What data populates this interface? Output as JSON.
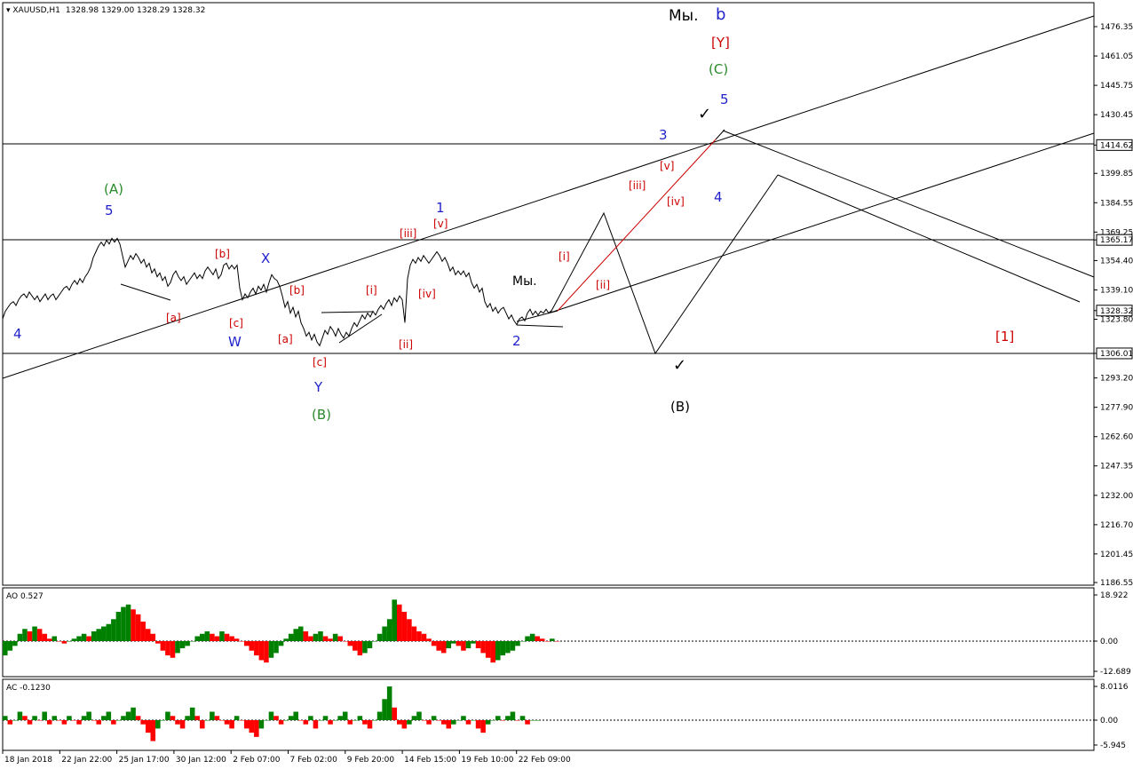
{
  "chart_data": {
    "type": "line",
    "header": {
      "symbol": "XAUUSD,H1",
      "ohlc": "1328.98 1329.00 1328.29 1328.32"
    },
    "price_axis": {
      "min": 1186.55,
      "max": 1476.35,
      "ticks": [
        "1476.35",
        "1461.05",
        "1445.75",
        "1430.45",
        "1414.62",
        "1399.85",
        "1384.55",
        "1369.25",
        "1365.17",
        "1354.40",
        "1339.10",
        "1328.32",
        "1323.80",
        "1306.01",
        "1293.20",
        "1277.90",
        "1262.60",
        "1247.35",
        "1232.00",
        "1216.70",
        "1201.45",
        "1186.55"
      ],
      "highlight_levels": [
        "1414.62",
        "1365.17",
        "1306.01",
        "1328.32"
      ]
    },
    "time_axis": {
      "ticks": [
        "18 Jan 2018",
        "22 Jan 22:00",
        "25 Jan 17:00",
        "30 Jan 12:00",
        "2 Feb 07:00",
        "7 Feb 02:00",
        "9 Feb 20:00",
        "14 Feb 15:00",
        "19 Feb 10:00",
        "22 Feb 09:00"
      ]
    },
    "price_series": [
      [
        0,
        1324
      ],
      [
        3,
        1328
      ],
      [
        6,
        1330
      ],
      [
        9,
        1332
      ],
      [
        12,
        1333
      ],
      [
        15,
        1331
      ],
      [
        18,
        1334
      ],
      [
        21,
        1336
      ],
      [
        24,
        1337
      ],
      [
        27,
        1335
      ],
      [
        30,
        1338
      ],
      [
        33,
        1336
      ],
      [
        36,
        1334
      ],
      [
        39,
        1336
      ],
      [
        42,
        1333
      ],
      [
        45,
        1335
      ],
      [
        48,
        1337
      ],
      [
        51,
        1334
      ],
      [
        54,
        1336
      ],
      [
        57,
        1337
      ],
      [
        60,
        1334
      ],
      [
        63,
        1336
      ],
      [
        66,
        1338
      ],
      [
        69,
        1340
      ],
      [
        72,
        1341
      ],
      [
        75,
        1339
      ],
      [
        78,
        1342
      ],
      [
        81,
        1344
      ],
      [
        84,
        1342
      ],
      [
        87,
        1345
      ],
      [
        90,
        1343
      ],
      [
        93,
        1346
      ],
      [
        96,
        1348
      ],
      [
        99,
        1351
      ],
      [
        102,
        1356
      ],
      [
        105,
        1359
      ],
      [
        108,
        1362
      ],
      [
        111,
        1364
      ],
      [
        114,
        1362
      ],
      [
        117,
        1365
      ],
      [
        120,
        1363
      ],
      [
        123,
        1366
      ],
      [
        126,
        1364
      ],
      [
        129,
        1366
      ],
      [
        132,
        1363
      ],
      [
        135,
        1357
      ],
      [
        138,
        1351
      ],
      [
        141,
        1354
      ],
      [
        144,
        1357
      ],
      [
        147,
        1355
      ],
      [
        150,
        1358
      ],
      [
        153,
        1356
      ],
      [
        156,
        1353
      ],
      [
        159,
        1355
      ],
      [
        162,
        1351
      ],
      [
        165,
        1353
      ],
      [
        168,
        1348
      ],
      [
        171,
        1350
      ],
      [
        174,
        1346
      ],
      [
        177,
        1348
      ],
      [
        180,
        1344
      ],
      [
        183,
        1346
      ],
      [
        186,
        1341
      ],
      [
        189,
        1343
      ],
      [
        192,
        1347
      ],
      [
        195,
        1349
      ],
      [
        198,
        1346
      ],
      [
        201,
        1344
      ],
      [
        204,
        1346
      ],
      [
        207,
        1342
      ],
      [
        210,
        1344
      ],
      [
        213,
        1346
      ],
      [
        216,
        1348
      ],
      [
        219,
        1345
      ],
      [
        222,
        1347
      ],
      [
        225,
        1345
      ],
      [
        228,
        1349
      ],
      [
        231,
        1351
      ],
      [
        234,
        1349
      ],
      [
        237,
        1347
      ],
      [
        240,
        1350
      ],
      [
        243,
        1345
      ],
      [
        246,
        1347
      ],
      [
        249,
        1352
      ],
      [
        252,
        1353
      ],
      [
        255,
        1350
      ],
      [
        258,
        1352
      ],
      [
        261,
        1350
      ],
      [
        264,
        1352
      ],
      [
        267,
        1340
      ],
      [
        270,
        1334
      ],
      [
        273,
        1337
      ],
      [
        276,
        1335
      ],
      [
        279,
        1338
      ],
      [
        282,
        1340
      ],
      [
        285,
        1337
      ],
      [
        288,
        1341
      ],
      [
        291,
        1339
      ],
      [
        294,
        1342
      ],
      [
        297,
        1338
      ],
      [
        300,
        1343
      ],
      [
        303,
        1347
      ],
      [
        306,
        1345
      ],
      [
        309,
        1344
      ],
      [
        312,
        1341
      ],
      [
        315,
        1336
      ],
      [
        318,
        1330
      ],
      [
        321,
        1333
      ],
      [
        324,
        1327
      ],
      [
        327,
        1330
      ],
      [
        330,
        1325
      ],
      [
        333,
        1328
      ],
      [
        336,
        1322
      ],
      [
        339,
        1319
      ],
      [
        342,
        1315
      ],
      [
        345,
        1317
      ],
      [
        348,
        1313
      ],
      [
        351,
        1316
      ],
      [
        354,
        1312
      ],
      [
        357,
        1310
      ],
      [
        360,
        1314
      ],
      [
        363,
        1318
      ],
      [
        366,
        1316
      ],
      [
        369,
        1320
      ],
      [
        372,
        1318
      ],
      [
        375,
        1315
      ],
      [
        378,
        1319
      ],
      [
        381,
        1316
      ],
      [
        384,
        1314
      ],
      [
        387,
        1317
      ],
      [
        390,
        1315
      ],
      [
        393,
        1319
      ],
      [
        396,
        1322
      ],
      [
        399,
        1320
      ],
      [
        402,
        1323
      ],
      [
        405,
        1326
      ],
      [
        408,
        1324
      ],
      [
        411,
        1327
      ],
      [
        414,
        1325
      ],
      [
        417,
        1328
      ],
      [
        420,
        1326
      ],
      [
        423,
        1329
      ],
      [
        426,
        1331
      ],
      [
        429,
        1329
      ],
      [
        432,
        1332
      ],
      [
        435,
        1334
      ],
      [
        438,
        1331
      ],
      [
        441,
        1335
      ],
      [
        444,
        1333
      ],
      [
        447,
        1336
      ],
      [
        450,
        1334
      ],
      [
        453,
        1322
      ],
      [
        456,
        1345
      ],
      [
        459,
        1352
      ],
      [
        462,
        1355
      ],
      [
        465,
        1353
      ],
      [
        468,
        1356
      ],
      [
        471,
        1354
      ],
      [
        474,
        1357
      ],
      [
        477,
        1355
      ],
      [
        480,
        1353
      ],
      [
        483,
        1355
      ],
      [
        486,
        1357
      ],
      [
        489,
        1359
      ],
      [
        492,
        1357
      ],
      [
        495,
        1354
      ],
      [
        498,
        1356
      ],
      [
        501,
        1353
      ],
      [
        504,
        1349
      ],
      [
        507,
        1351
      ],
      [
        510,
        1347
      ],
      [
        513,
        1349
      ],
      [
        516,
        1347
      ],
      [
        519,
        1349
      ],
      [
        522,
        1346
      ],
      [
        525,
        1348
      ],
      [
        528,
        1343
      ],
      [
        531,
        1340
      ],
      [
        534,
        1342
      ],
      [
        537,
        1338
      ],
      [
        540,
        1340
      ],
      [
        543,
        1333
      ],
      [
        546,
        1330
      ],
      [
        549,
        1332
      ],
      [
        552,
        1328
      ],
      [
        555,
        1330
      ],
      [
        558,
        1327
      ],
      [
        561,
        1329
      ],
      [
        564,
        1330
      ],
      [
        567,
        1327
      ],
      [
        570,
        1324
      ],
      [
        573,
        1326
      ],
      [
        576,
        1323
      ],
      [
        579,
        1321
      ],
      [
        582,
        1324
      ],
      [
        585,
        1325
      ],
      [
        588,
        1323
      ],
      [
        591,
        1327
      ],
      [
        594,
        1329
      ],
      [
        597,
        1326
      ],
      [
        600,
        1328
      ],
      [
        603,
        1326
      ],
      [
        606,
        1328
      ],
      [
        609,
        1327
      ],
      [
        612,
        1329
      ],
      [
        615,
        1327
      ],
      [
        618,
        1328.32
      ]
    ],
    "wave_labels": [
      {
        "text": "4",
        "color": "#2222cc"
      },
      {
        "text": "(A)",
        "color": "#2a8a2a"
      },
      {
        "text": "5",
        "color": "#2222cc"
      },
      {
        "text": "[a]",
        "color": "#cc0000"
      },
      {
        "text": "[b]",
        "color": "#cc0000"
      },
      {
        "text": "[c]",
        "color": "#cc0000"
      },
      {
        "text": "W",
        "color": "#2222cc"
      },
      {
        "text": "X",
        "color": "#2222cc"
      },
      {
        "text": "[b]",
        "color": "#cc0000"
      },
      {
        "text": "[a]",
        "color": "#cc0000"
      },
      {
        "text": "[c]",
        "color": "#cc0000"
      },
      {
        "text": "Y",
        "color": "#2222cc"
      },
      {
        "text": "(B)",
        "color": "#2a8a2a"
      },
      {
        "text": "[i]",
        "color": "#cc0000"
      },
      {
        "text": "[ii]",
        "color": "#cc0000"
      },
      {
        "text": "[iii]",
        "color": "#cc0000"
      },
      {
        "text": "[iv]",
        "color": "#cc0000"
      },
      {
        "text": "[v]",
        "color": "#cc0000"
      },
      {
        "text": "1",
        "color": "#2222cc"
      },
      {
        "text": "Мы.",
        "color": "#000000"
      },
      {
        "text": "2",
        "color": "#2222cc"
      },
      {
        "text": "[i]",
        "color": "#cc0000"
      },
      {
        "text": "[ii]",
        "color": "#cc0000"
      },
      {
        "text": "[iii]",
        "color": "#cc0000"
      },
      {
        "text": "[iv]",
        "color": "#cc0000"
      },
      {
        "text": "[v]",
        "color": "#cc0000"
      },
      {
        "text": "3",
        "color": "#2222cc"
      },
      {
        "text": "4",
        "color": "#2222cc"
      },
      {
        "text": "5",
        "color": "#2222cc"
      },
      {
        "text": "(C)",
        "color": "#2a8a2a"
      },
      {
        "text": "[Y]",
        "color": "#cc0000"
      },
      {
        "text": "Мы.",
        "color": "#000000"
      },
      {
        "text": "b",
        "color": "#2222cc"
      },
      {
        "text": "✓",
        "color": "#000000"
      },
      {
        "text": "✓",
        "color": "#000000"
      },
      {
        "text": "(B)",
        "color": "#000000"
      },
      {
        "text": "[1]",
        "color": "#cc0000"
      }
    ],
    "ao": {
      "title": "AO 0.527",
      "ymax": 18.922,
      "ymin": -12.689,
      "ticks": [
        "18.922",
        "0.00",
        "-12.689"
      ],
      "values": [
        -6,
        -4,
        -2,
        3,
        5,
        4,
        6,
        5,
        3,
        1,
        2,
        0,
        -1,
        0,
        1,
        2,
        3,
        2,
        4,
        5,
        6,
        7,
        9,
        12,
        14,
        15,
        13,
        11,
        8,
        5,
        3,
        -1,
        -4,
        -6,
        -7,
        -5,
        -3,
        -2,
        0,
        2,
        3,
        4,
        3,
        2,
        4,
        3,
        2,
        1,
        0,
        -2,
        -4,
        -6,
        -8,
        -9,
        -7,
        -5,
        -2,
        1,
        3,
        5,
        6,
        4,
        2,
        3,
        4,
        2,
        1,
        3,
        2,
        0,
        -2,
        -4,
        -6,
        -5,
        -3,
        0,
        3,
        6,
        9,
        17,
        15,
        12,
        9,
        6,
        4,
        3,
        1,
        -2,
        -4,
        -5,
        -3,
        -1,
        -2,
        -4,
        -3,
        -1,
        -3,
        -5,
        -7,
        -9,
        -8,
        -6,
        -5,
        -4,
        -2,
        0,
        2,
        3,
        2,
        1,
        0,
        1,
        0
      ]
    },
    "ac": {
      "title": "AC -0.1230",
      "ymax": 8.0116,
      "ymin": -5.945,
      "ticks": [
        "8.0116",
        "0.00",
        "-5.945"
      ],
      "values": [
        1,
        -1,
        0,
        2,
        1,
        -1,
        1,
        0,
        2,
        -1,
        1,
        0,
        -1,
        1,
        0,
        -1,
        1,
        2,
        0,
        -1,
        1,
        2,
        -1,
        0,
        1,
        2,
        3,
        1,
        -1,
        -3,
        -5,
        -2,
        0,
        2,
        1,
        -1,
        -2,
        1,
        3,
        1,
        -2,
        0,
        2,
        1,
        0,
        -1,
        -2,
        1,
        0,
        -2,
        -3,
        -4,
        -2,
        0,
        2,
        1,
        -1,
        0,
        1,
        2,
        0,
        -1,
        1,
        -2,
        0,
        1,
        -1,
        0,
        1,
        2,
        -1,
        0,
        1,
        -1,
        -2,
        0,
        2,
        5,
        8,
        3,
        -1,
        -2,
        -1,
        1,
        2,
        0,
        -1,
        1,
        0,
        -1,
        -2,
        -1,
        0,
        1,
        -1,
        0,
        -2,
        -3,
        -1,
        0,
        1,
        0,
        1,
        2,
        0,
        1,
        -1,
        0,
        0
      ]
    }
  }
}
